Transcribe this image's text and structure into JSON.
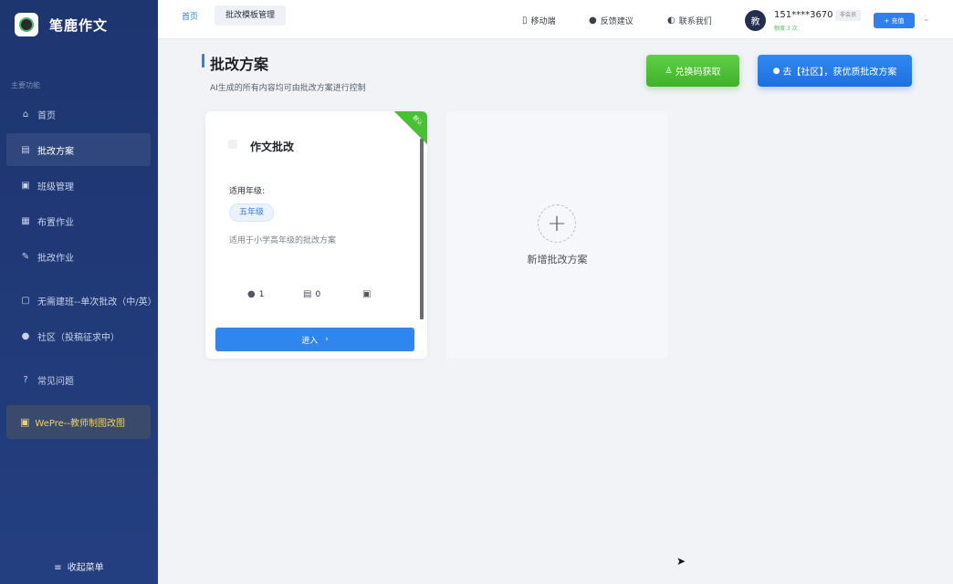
{
  "app": {
    "name": "笔鹿作文"
  },
  "sidebar": {
    "section_label": "主要功能",
    "items": [
      {
        "label": "首页",
        "icon": "home-icon"
      },
      {
        "label": "批改方案",
        "icon": "document-icon",
        "active": true
      },
      {
        "label": "班级管理",
        "icon": "class-icon"
      },
      {
        "label": "布置作业",
        "icon": "assign-icon"
      },
      {
        "label": "批改作业",
        "icon": "pen-icon"
      },
      {
        "label": "无需建班--单次批改（中/英）",
        "icon": "doc-icon"
      },
      {
        "label": "社区（投稿征求中）",
        "icon": "person-icon"
      },
      {
        "label": "常见问题",
        "icon": "question-icon"
      }
    ],
    "wepre": {
      "label": "WePre--教师制图改图",
      "icon": "gift-icon"
    },
    "collapse_label": "收起菜单"
  },
  "topbar": {
    "breadcrumb_home": "首页",
    "breadcrumb_current": "批改模板管理",
    "links": [
      {
        "label": "移动端",
        "icon": "phone-icon"
      },
      {
        "label": "反馈建议",
        "icon": "chat-icon"
      },
      {
        "label": "联系我们",
        "icon": "headset-icon"
      }
    ],
    "user": {
      "avatar_text": "教",
      "phone": "151****3670",
      "sub": "额度 3 次",
      "tag": "非会员",
      "recharge_label": "+ 充值"
    }
  },
  "page": {
    "title": "批改方案",
    "description": "AI生成的所有内容均可由批改方案进行控制",
    "redeem_button": "兑换码获取",
    "community_button": "去【社区】，获优质批改方案"
  },
  "plan_card": {
    "corner_label": "默认",
    "name": "作文批改",
    "grade_label": "适用年级:",
    "grade": "五年级",
    "description": "适用于小学高年级的批改方案",
    "stats": {
      "users": "1",
      "docs": "0"
    },
    "enter_label": "进入"
  },
  "add_card": {
    "label": "新增批改方案"
  }
}
